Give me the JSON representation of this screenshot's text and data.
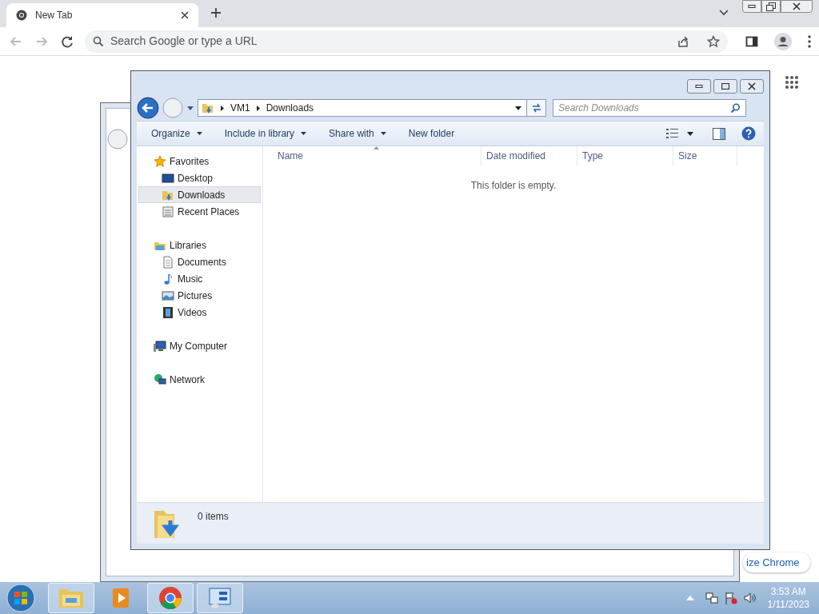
{
  "browser": {
    "tabs": [
      {
        "title": "New Tab",
        "selected": true
      }
    ],
    "omnibox": {
      "placeholder": "Search Google or type a URL"
    },
    "customize_button": "ize Chrome"
  },
  "explorer": {
    "path": [
      "VM1",
      "Downloads"
    ],
    "search": {
      "placeholder": "Search Downloads"
    },
    "toolbar": [
      {
        "label": "Organize",
        "menu": true
      },
      {
        "label": "Include in library",
        "menu": true
      },
      {
        "label": "Share with",
        "menu": true
      },
      {
        "label": "New folder",
        "menu": false
      }
    ],
    "nav": [
      {
        "label": "Favorites",
        "kind": "star",
        "children": [
          {
            "label": "Desktop",
            "kind": "desktop",
            "selected": false
          },
          {
            "label": "Downloads",
            "kind": "downloads",
            "selected": true
          },
          {
            "label": "Recent Places",
            "kind": "recent",
            "selected": false
          }
        ]
      },
      {
        "label": "Libraries",
        "kind": "library",
        "children": [
          {
            "label": "Documents",
            "kind": "document",
            "selected": false
          },
          {
            "label": "Music",
            "kind": "music",
            "selected": false
          },
          {
            "label": "Pictures",
            "kind": "pictures",
            "selected": false
          },
          {
            "label": "Videos",
            "kind": "videos",
            "selected": false
          }
        ]
      },
      {
        "label": "My Computer",
        "kind": "computer"
      },
      {
        "label": "Network",
        "kind": "network"
      }
    ],
    "columns": [
      "Name",
      "Date modified",
      "Type",
      "Size"
    ],
    "empty_message": "This folder is empty.",
    "status": "0 items"
  },
  "taskbar": {
    "items": [
      {
        "kind": "explorer",
        "selected": true
      },
      {
        "kind": "media",
        "selected": false
      },
      {
        "kind": "chrome",
        "selected": true
      },
      {
        "kind": "panel",
        "selected": true
      }
    ],
    "time": "3:53 AM",
    "date": "1/11/2023"
  }
}
